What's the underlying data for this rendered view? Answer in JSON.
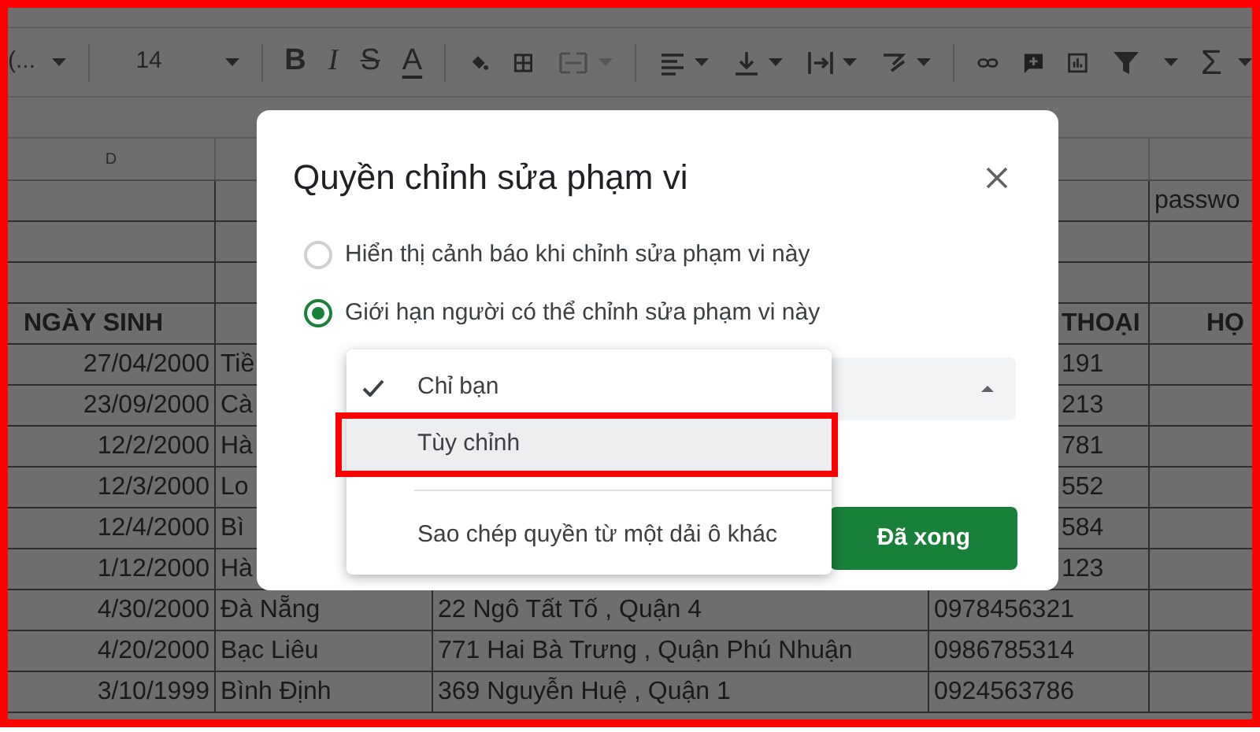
{
  "toolbar": {
    "font": "(...",
    "font_size": "14",
    "format_letters": [
      "B",
      "I",
      "S",
      "A"
    ],
    "function_symbol": "Σ"
  },
  "sheet": {
    "column_header": "D",
    "rows": [
      {
        "kind": "data",
        "H": "passwo"
      },
      {
        "kind": "data"
      },
      {
        "kind": "data"
      },
      {
        "kind": "header",
        "covered": true,
        "D": "NGÀY SINH",
        "G": "THOẠI",
        "H": "HỌ"
      },
      {
        "kind": "data",
        "covered": true,
        "D": "27/04/2000",
        "E": "Tiề",
        "G": "191"
      },
      {
        "kind": "data",
        "covered": true,
        "D": "23/09/2000",
        "E": "Cà",
        "G": "213"
      },
      {
        "kind": "data",
        "covered": true,
        "D": "12/2/2000",
        "E": "Hà",
        "G": "781"
      },
      {
        "kind": "data",
        "covered": true,
        "D": "12/3/2000",
        "E": "Lo",
        "G": "552"
      },
      {
        "kind": "data",
        "covered": true,
        "D": "12/4/2000",
        "E": "Bì",
        "G": "584"
      },
      {
        "kind": "data",
        "covered": true,
        "D": "1/12/2000",
        "E": "Hà",
        "G": "123"
      },
      {
        "kind": "data",
        "covered": false,
        "D": "4/30/2000",
        "E": "Đà Nẵng",
        "F": "22 Ngô Tất Tố , Quận 4",
        "G": "0978456321"
      },
      {
        "kind": "data",
        "covered": false,
        "D": "4/20/2000",
        "E": "Bạc Liêu",
        "F": "771 Hai Bà Trưng , Quận Phú Nhuận",
        "G": "0986785314"
      },
      {
        "kind": "data",
        "covered": false,
        "D": "3/10/1999",
        "E": "Bình Định",
        "F": "369 Nguyễn Huệ , Quận 1",
        "G": "0924563786"
      }
    ]
  },
  "dialog": {
    "title": "Quyền chỉnh sửa phạm vi",
    "options": [
      {
        "label": "Hiển thị cảnh báo khi chỉnh sửa phạm vi này",
        "selected": false
      },
      {
        "label": "Giới hạn người có thể chỉnh sửa phạm vi này",
        "selected": true
      }
    ],
    "menu": [
      {
        "kind": "option",
        "label": "Chỉ bạn",
        "checked": true,
        "highlighted": false,
        "annotated": false
      },
      {
        "kind": "option",
        "label": "Tùy chỉnh",
        "checked": false,
        "highlighted": true,
        "annotated": true
      },
      {
        "kind": "action",
        "label": "Sao chép quyền từ một dải ô khác",
        "checked": false,
        "highlighted": false,
        "annotated": false
      }
    ],
    "button": "Đã xong"
  }
}
